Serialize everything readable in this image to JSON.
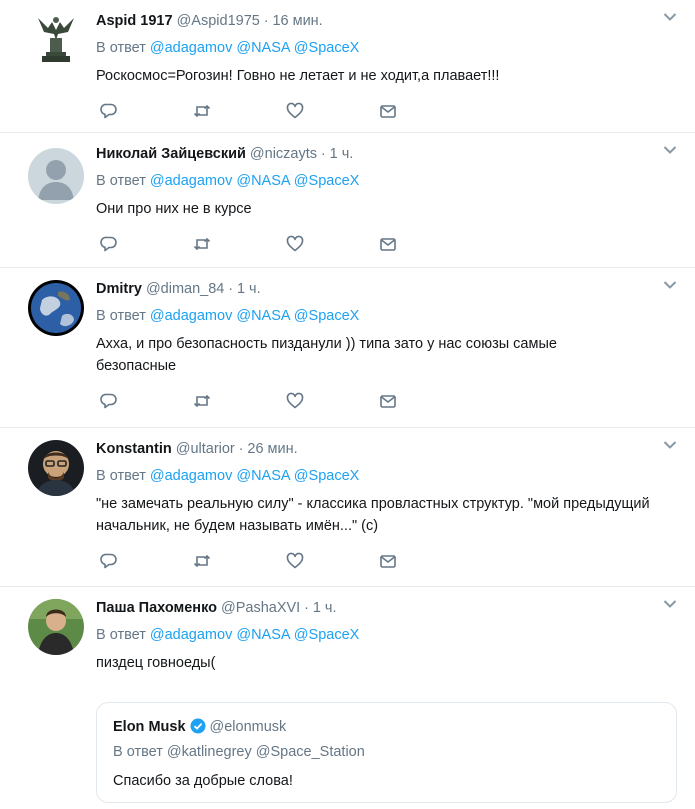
{
  "tweets": [
    {
      "name": "Aspid 1917",
      "handle": "@Aspid1975",
      "dot": "·",
      "time": "16 мин.",
      "reply_prefix": "В ответ",
      "mentions": [
        "@adagamov",
        "@NASA",
        "@SpaceX"
      ],
      "text": "Роскосмос=Рогозин! Говно не летает и не ходит,а плавает!!!",
      "avatar": "statue-avatar"
    },
    {
      "name": "Николай Зайцевский",
      "handle": "@niczayts",
      "dot": "·",
      "time": "1 ч.",
      "reply_prefix": "В ответ",
      "mentions": [
        "@adagamov",
        "@NASA",
        "@SpaceX"
      ],
      "text": "Они про них не в курсе",
      "avatar": "default-avatar"
    },
    {
      "name": "Dmitry",
      "handle": "@diman_84",
      "dot": "·",
      "time": "1 ч.",
      "reply_prefix": "В ответ",
      "mentions": [
        "@adagamov",
        "@NASA",
        "@SpaceX"
      ],
      "text": "Ахха, и про безопасность пизданули )) типа зато у нас союзы самые безопасные",
      "avatar": "earth-avatar"
    },
    {
      "name": "Konstantin",
      "handle": "@ultarior",
      "dot": "·",
      "time": "26 мин.",
      "reply_prefix": "В ответ",
      "mentions": [
        "@adagamov",
        "@NASA",
        "@SpaceX"
      ],
      "text": "\"не замечать реальную силу\" - классика провластных структур. \"мой предыдущий начальник, не будем называть имён...\" (с)",
      "avatar": "person-glasses-avatar"
    },
    {
      "name": "Паша Пахоменко",
      "handle": "@PashaXVI",
      "dot": "·",
      "time": "1 ч.",
      "reply_prefix": "В ответ",
      "mentions": [
        "@adagamov",
        "@NASA",
        "@SpaceX"
      ],
      "text": "пиздец говноеды(",
      "avatar": "person-outdoor-avatar",
      "quote": {
        "name": "Elon Musk",
        "handle": "@elonmusk",
        "reply_prefix": "В ответ",
        "mentions": [
          "@katlinegrey",
          "@Space_Station"
        ],
        "text": "Спасибо за добрые слова!"
      }
    }
  ],
  "icons": {
    "reply": "reply-icon",
    "retweet": "retweet-icon",
    "like": "heart-icon",
    "message": "envelope-icon",
    "more": "chevron-down-icon",
    "verified": "verified-badge-icon"
  },
  "colors": {
    "link": "#1da1f2",
    "muted": "#657786",
    "text": "#14171a",
    "border": "#e6ecf0"
  }
}
